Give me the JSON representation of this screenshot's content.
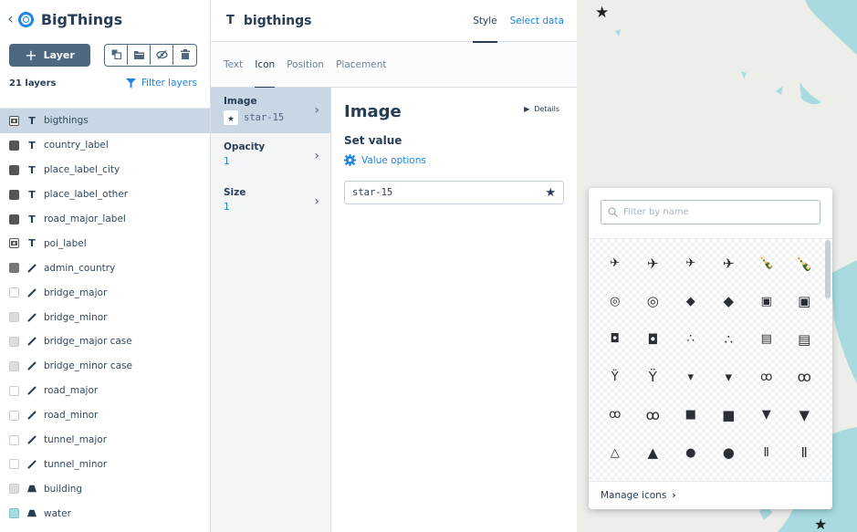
{
  "app": {
    "title": "BigThings"
  },
  "toolbar": {
    "add_layer_label": "Layer",
    "icons": [
      "duplicate-icon",
      "folder-icon",
      "hide-icon",
      "trash-icon"
    ]
  },
  "layers_header": {
    "count": "21 layers",
    "filter_label": "Filter layers"
  },
  "layers": [
    {
      "name": "bigthings",
      "type": "T",
      "swatch": "image",
      "active": true
    },
    {
      "name": "country_label",
      "type": "T",
      "swatch": "#555"
    },
    {
      "name": "place_label_city",
      "type": "T",
      "swatch": "#555"
    },
    {
      "name": "place_label_other",
      "type": "T",
      "swatch": "#555"
    },
    {
      "name": "road_major_label",
      "type": "T",
      "swatch": "#555"
    },
    {
      "name": "poi_label",
      "type": "T",
      "swatch": "image"
    },
    {
      "name": "admin_country",
      "type": "line",
      "swatch": "#777"
    },
    {
      "name": "bridge_major",
      "type": "line",
      "swatch": "#fff"
    },
    {
      "name": "bridge_minor",
      "type": "line",
      "swatch": "#ddd"
    },
    {
      "name": "bridge_major case",
      "type": "line",
      "swatch": "#ddd"
    },
    {
      "name": "bridge_minor case",
      "type": "line",
      "swatch": "#ddd"
    },
    {
      "name": "road_major",
      "type": "line",
      "swatch": "#fff"
    },
    {
      "name": "road_minor",
      "type": "line",
      "swatch": "#fff"
    },
    {
      "name": "tunnel_major",
      "type": "line",
      "swatch": "#fff"
    },
    {
      "name": "tunnel_minor",
      "type": "line",
      "swatch": "#fff"
    },
    {
      "name": "building",
      "type": "fill",
      "swatch": "#ddd"
    },
    {
      "name": "water",
      "type": "fill",
      "swatch": "#a8dae0"
    }
  ],
  "panel": {
    "layer_name": "bigthings",
    "layer_type_icon": "T",
    "tab_style": "Style",
    "tab_select_data": "Select data",
    "sub_tabs": [
      "Text",
      "Icon",
      "Position",
      "Placement"
    ],
    "active_sub_tab": "Icon"
  },
  "properties": [
    {
      "label": "Image",
      "value": "star-15",
      "active": true,
      "has_icon": true
    },
    {
      "label": "Opacity",
      "value": "1"
    },
    {
      "label": "Size",
      "value": "1"
    }
  ],
  "editor": {
    "title": "Image",
    "details_label": "Details",
    "set_value_label": "Set value",
    "value_options_label": "Value options",
    "value": "star-15"
  },
  "picker": {
    "search_placeholder": "Filter by name",
    "footer_label": "Manage icons",
    "icons": [
      {
        "name": "airport-icon",
        "glyph": "✈"
      },
      {
        "name": "airport-icon",
        "glyph": "✈"
      },
      {
        "name": "airfield-icon",
        "glyph": "✈"
      },
      {
        "name": "airfield-icon",
        "glyph": "✈"
      },
      {
        "name": "alcohol-shop-icon",
        "glyph": "🍾"
      },
      {
        "name": "alcohol-shop-icon",
        "glyph": "🍾"
      },
      {
        "name": "amusement-park-icon",
        "glyph": "◎"
      },
      {
        "name": "amusement-park-icon",
        "glyph": "◎"
      },
      {
        "name": "aquarium-icon",
        "glyph": "◆"
      },
      {
        "name": "aquarium-icon",
        "glyph": "◆"
      },
      {
        "name": "art-gallery-icon",
        "glyph": "▣"
      },
      {
        "name": "art-gallery-icon",
        "glyph": "▣"
      },
      {
        "name": "attraction-icon",
        "glyph": "◘"
      },
      {
        "name": "attraction-icon",
        "glyph": "◘"
      },
      {
        "name": "bakery-icon",
        "glyph": "∴"
      },
      {
        "name": "bakery-icon",
        "glyph": "∴"
      },
      {
        "name": "bank-icon",
        "glyph": "▤"
      },
      {
        "name": "bank-icon",
        "glyph": "▤"
      },
      {
        "name": "bar-icon",
        "glyph": "Ϋ"
      },
      {
        "name": "bar-icon",
        "glyph": "Ϋ"
      },
      {
        "name": "beer-icon",
        "glyph": "▾"
      },
      {
        "name": "beer-icon",
        "glyph": "▾"
      },
      {
        "name": "bicycle-icon",
        "glyph": "ꝏ"
      },
      {
        "name": "bicycle-icon",
        "glyph": "ꝏ"
      },
      {
        "name": "bicycle-share-icon",
        "glyph": "ꝏ"
      },
      {
        "name": "bicycle-share-icon",
        "glyph": "ꝏ"
      },
      {
        "name": "bus-icon",
        "glyph": "■"
      },
      {
        "name": "bus-icon",
        "glyph": "■"
      },
      {
        "name": "cafe-icon",
        "glyph": "▼"
      },
      {
        "name": "cafe-icon",
        "glyph": "▼"
      },
      {
        "name": "campsite-icon",
        "glyph": "△"
      },
      {
        "name": "campsite-icon",
        "glyph": "▲"
      },
      {
        "name": "car-icon",
        "glyph": "●"
      },
      {
        "name": "car-icon",
        "glyph": "●"
      },
      {
        "name": "castle-icon",
        "glyph": "Ⅱ"
      },
      {
        "name": "castle-icon",
        "glyph": "Ⅱ"
      }
    ]
  },
  "colors": {
    "accent": "#1b86e7",
    "selected_row": "#c9d6e3",
    "water": "#a8dae0",
    "land": "#ededea"
  }
}
